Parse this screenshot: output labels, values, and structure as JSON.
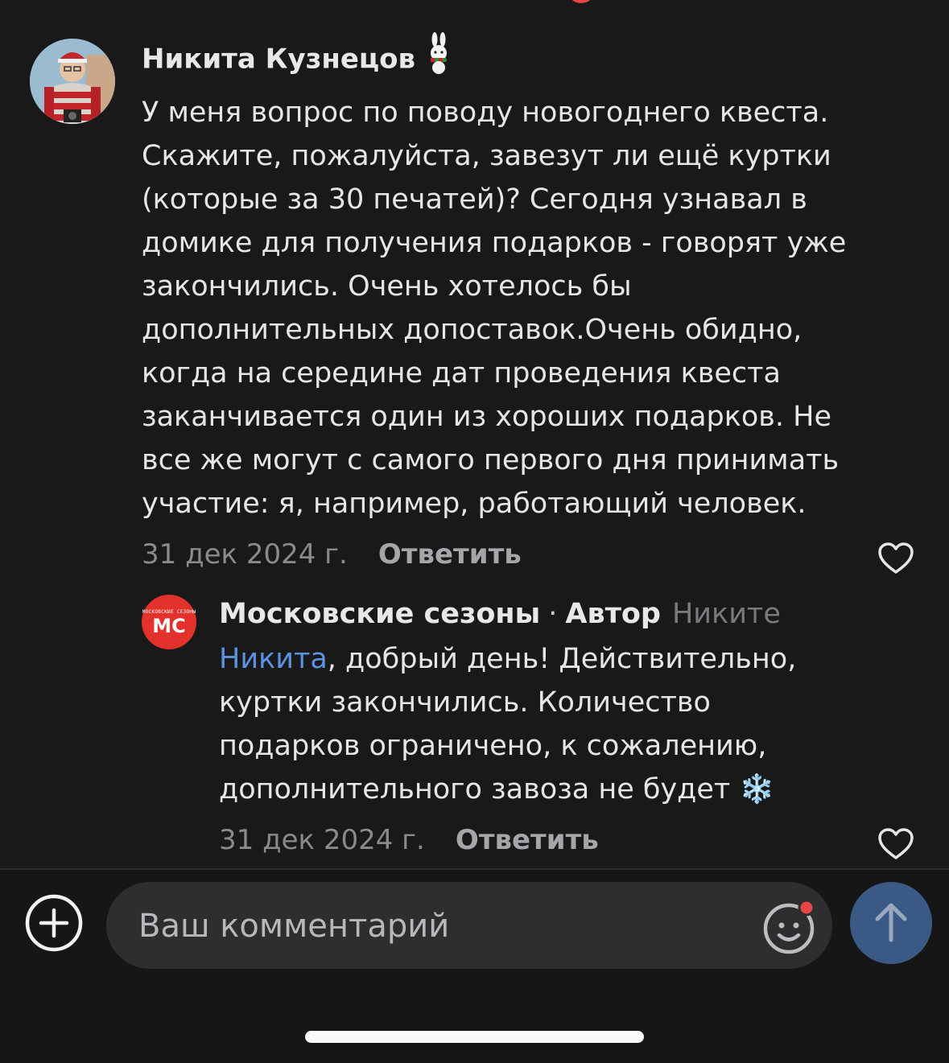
{
  "comment": {
    "author": "Никита Кузнецов",
    "text": "У меня вопрос по поводу новогоднего квеста.\nСкажите, пожалуйста, завезут ли ещё куртки\n(которые за 30 печатей)? Сегодня узнавал в\nдомике для получения подарков - говорят уже\nзакончились. Очень хотелось бы\nдополнительных допоставок.Очень обидно,\nкогда на середине дат проведения квеста\nзаканчивается один из хороших подарков. Не\nвсе же могут с самого первого дня принимать\nучастие: я, например, работающий человек.",
    "date": "31 дек 2024 г.",
    "reply_label": "Ответить"
  },
  "reply": {
    "author": "Московские сезоны",
    "separator": "·",
    "author_tag": "Автор",
    "to": "Никите",
    "avatar_small_text": "МОСКОВСКИЕ СЕЗОНЫ",
    "avatar_logo": "МС",
    "mention": "Никита",
    "text": ", добрый день! Действительно,\nкуртки закончились. Количество\nподарков ограничено, к сожалению,\nдополнительного завоза не будет ",
    "emoji": "❄️",
    "date": "31 дек 2024 г.",
    "reply_label": "Ответить"
  },
  "composer": {
    "placeholder": "Ваш комментарий"
  },
  "colors": {
    "background": "#19191a",
    "accent_link": "#5b93e0",
    "send_button": "#3a5a85",
    "brand_red": "#e3322b",
    "notification_dot": "#e64646"
  },
  "icons": [
    "heart-icon",
    "plus-circle-icon",
    "smiley-icon",
    "arrow-up-icon",
    "bunny-badge-icon"
  ]
}
